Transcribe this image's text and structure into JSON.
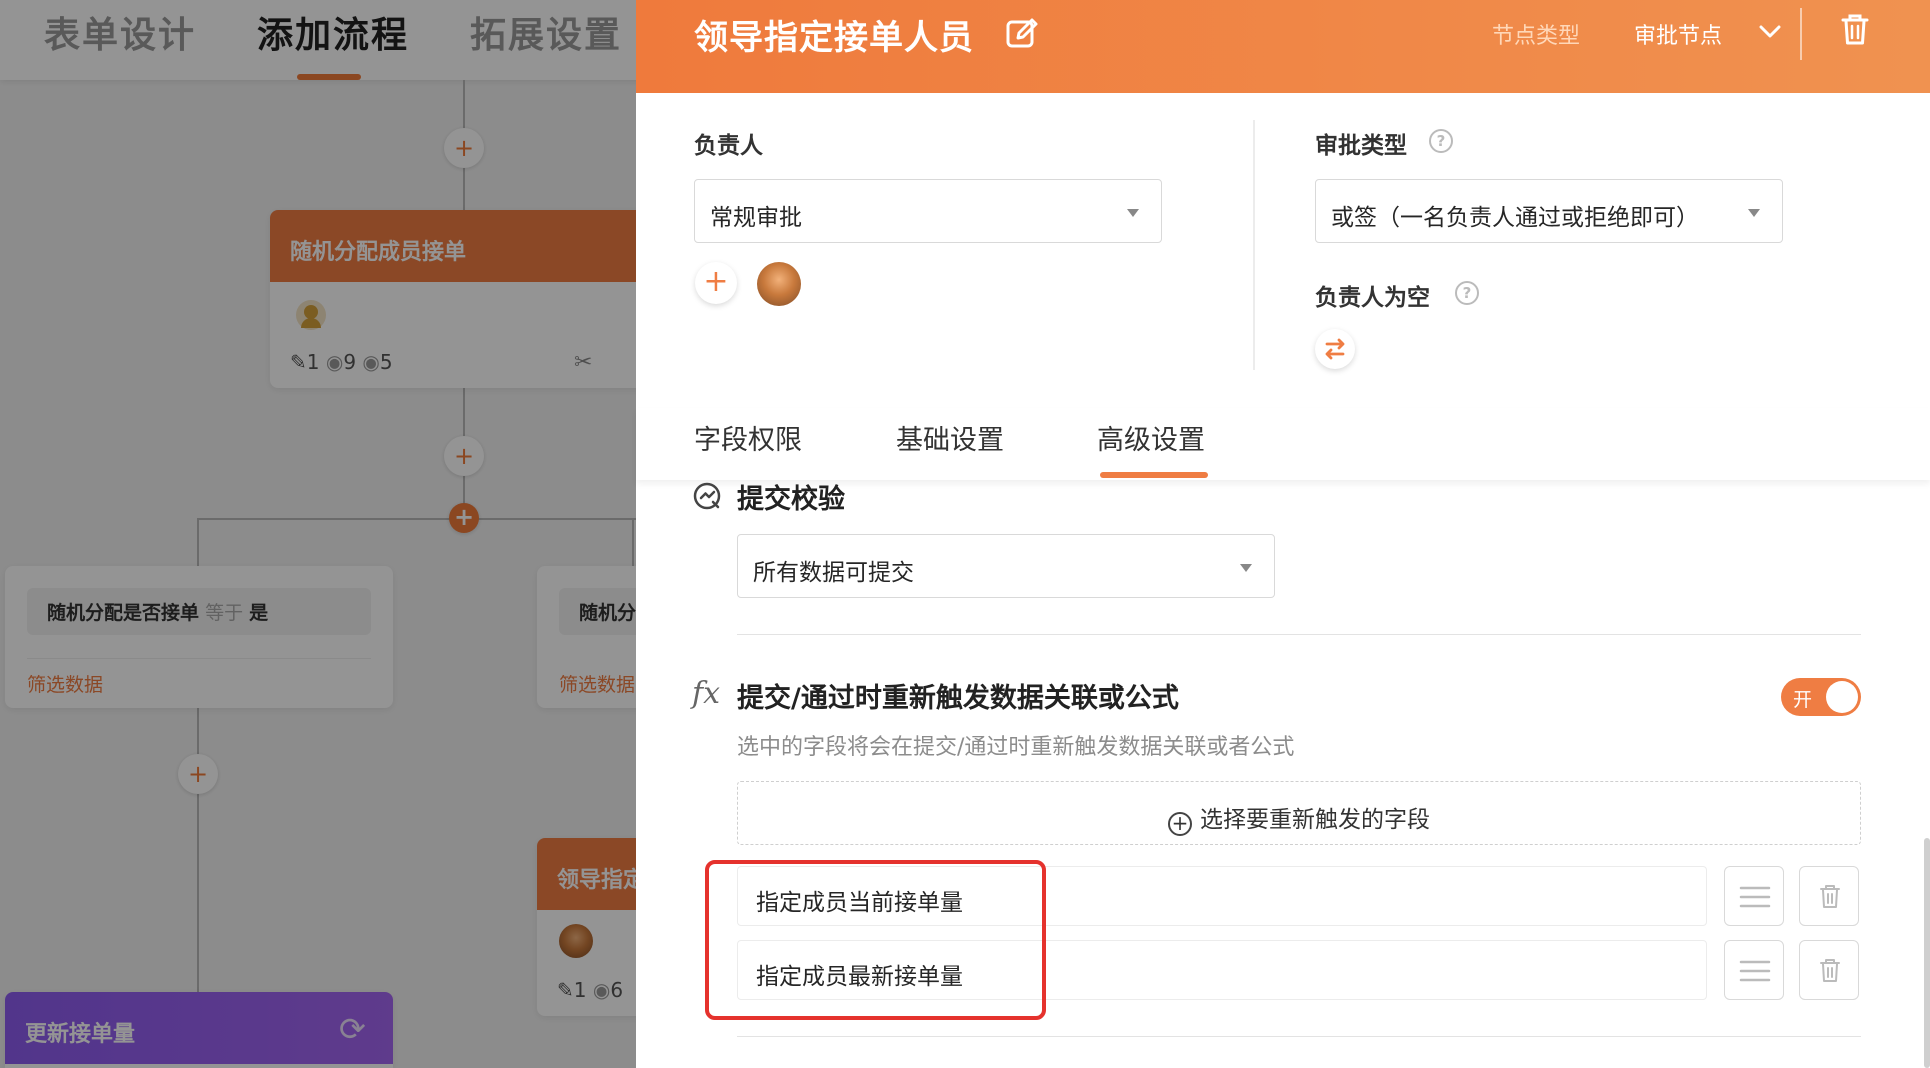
{
  "background": {
    "nav_tabs": [
      "表单设计",
      "添加流程",
      "拓展设置"
    ],
    "node_random_assign": {
      "title": "随机分配成员接单",
      "stat_edit": "1",
      "stat_view": "9",
      "stat_eye": "5"
    },
    "condition_left": {
      "field": "随机分配是否接单",
      "op": "等于",
      "value": "是",
      "filter_link": "筛选数据"
    },
    "condition_right": {
      "field": "随机分",
      "filter_link": "筛选数据"
    },
    "node_leader_assign": {
      "title": "领导指定",
      "stat_edit": "1",
      "stat_view": "6"
    },
    "node_update": {
      "title": "更新接单量"
    }
  },
  "panel": {
    "title": "领导指定接单人员",
    "node_type_label": "节点类型",
    "node_type_value": "审批节点",
    "owner_label": "负责人",
    "owner_select": "常规审批",
    "approval_type_label": "审批类型",
    "approval_type_select": "或签（一名负责人通过或拒绝即可）",
    "empty_owner_label": "负责人为空",
    "tabs": [
      "字段权限",
      "基础设置",
      "高级设置"
    ],
    "submit_check_title": "提交校验",
    "submit_check_select": "所有数据可提交",
    "retrigger_title": "提交/通过时重新触发数据关联或公式",
    "retrigger_toggle": "开",
    "retrigger_desc": "选中的字段将会在提交/通过时重新触发数据关联或者公式",
    "select_fields_button": "选择要重新触发的字段",
    "fields": [
      "指定成员当前接单量",
      "指定成员最新接单量"
    ]
  },
  "colors": {
    "accent": "#ef7d43",
    "highlight": "#e5322d",
    "purple": "#8d5cf0"
  }
}
